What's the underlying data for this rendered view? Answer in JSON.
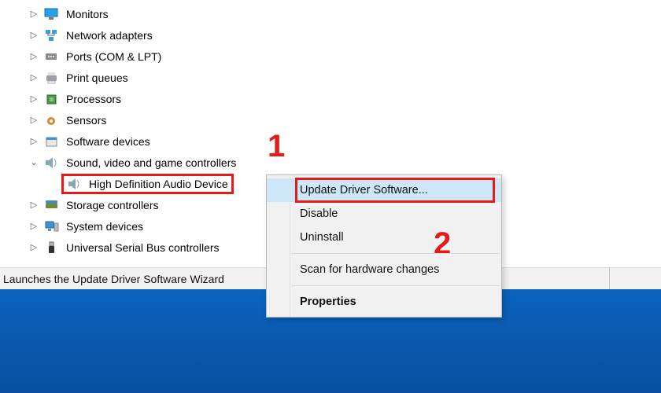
{
  "tree": {
    "items": [
      {
        "label": "Monitors",
        "expanded": false,
        "icon": "monitor-icon"
      },
      {
        "label": "Network adapters",
        "expanded": false,
        "icon": "network-icon"
      },
      {
        "label": "Ports (COM & LPT)",
        "expanded": false,
        "icon": "port-icon"
      },
      {
        "label": "Print queues",
        "expanded": false,
        "icon": "printer-icon"
      },
      {
        "label": "Processors",
        "expanded": false,
        "icon": "cpu-icon"
      },
      {
        "label": "Sensors",
        "expanded": false,
        "icon": "sensor-icon"
      },
      {
        "label": "Software devices",
        "expanded": false,
        "icon": "software-icon"
      },
      {
        "label": "Sound, video and game controllers",
        "expanded": true,
        "icon": "speaker-icon",
        "children": [
          {
            "label": "High Definition Audio Device",
            "icon": "speaker-icon",
            "highlighted": true
          }
        ]
      },
      {
        "label": "Storage controllers",
        "expanded": false,
        "icon": "storage-icon"
      },
      {
        "label": "System devices",
        "expanded": false,
        "icon": "system-icon"
      },
      {
        "label": "Universal Serial Bus controllers",
        "expanded": false,
        "icon": "usb-icon"
      }
    ]
  },
  "statusbar": {
    "text": "Launches the Update Driver Software Wizard"
  },
  "menu": {
    "items": [
      {
        "label": "Update Driver Software...",
        "selected": true,
        "redbox": true
      },
      {
        "label": "Disable"
      },
      {
        "label": "Uninstall"
      },
      {
        "sep": true
      },
      {
        "label": "Scan for hardware changes"
      },
      {
        "sep": true
      },
      {
        "label": "Properties",
        "bold": true
      }
    ]
  },
  "annotations": {
    "one": "1",
    "two": "2"
  },
  "colors": {
    "highlight_red": "#e31b1b",
    "menu_selected": "#cde7f8"
  }
}
